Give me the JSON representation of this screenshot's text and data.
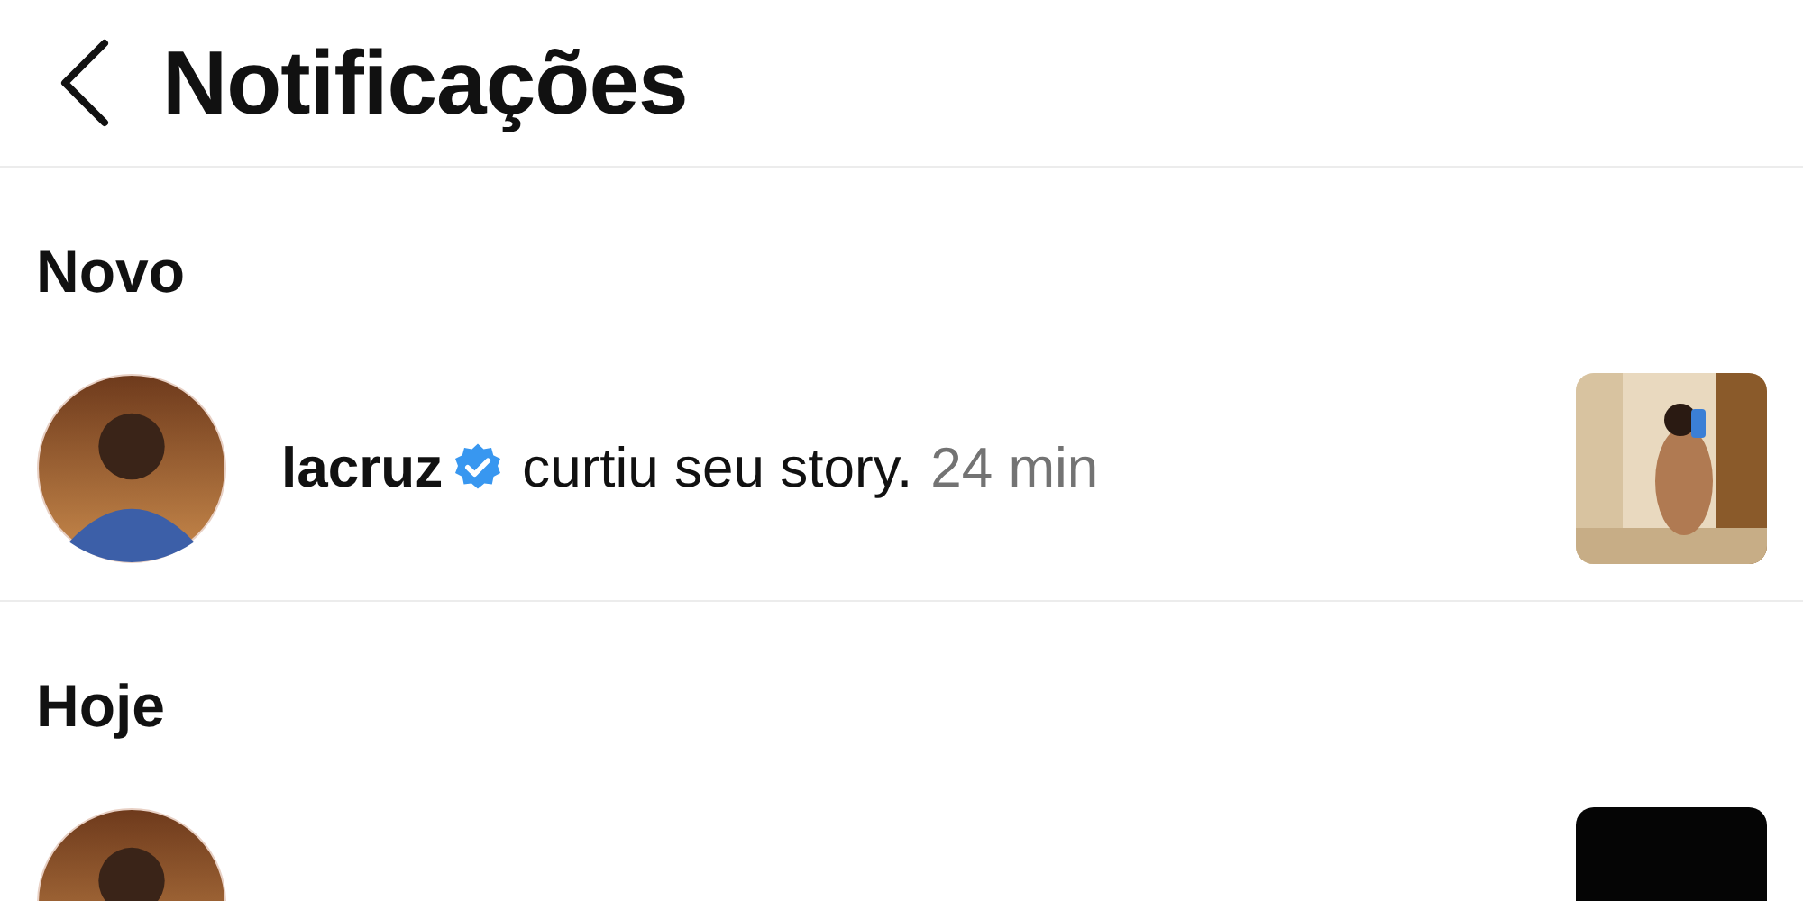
{
  "header": {
    "title": "Notificações"
  },
  "sections": [
    {
      "title": "Novo",
      "notifications": [
        {
          "username": "lacruz",
          "verified": true,
          "action": "curtiu seu story.",
          "time": "24 min"
        }
      ]
    },
    {
      "title": "Hoje"
    }
  ]
}
